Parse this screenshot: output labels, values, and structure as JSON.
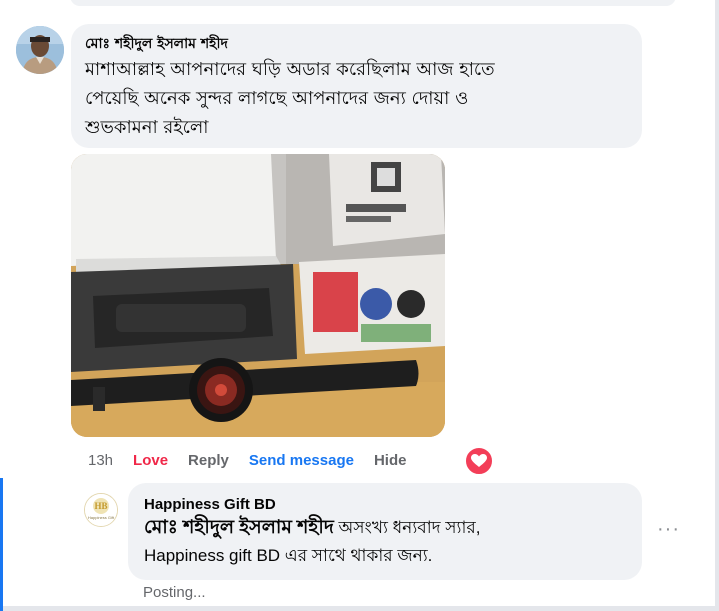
{
  "comment": {
    "author": "মোঃ শহীদুল ইসলাম শহীদ",
    "lines": [
      "মাশাআল্লাহ আপনাদের ঘড়ি অডার করেছিলাম আজ হাতে",
      "পেয়েছি অনেক সুন্দর লাগছে আপনাদের জন্য দোয়া ও",
      "শুভকামনা রইলো"
    ]
  },
  "actions": {
    "time": "13h",
    "love": "Love",
    "reply": "Reply",
    "send_message": "Send message",
    "hide": "Hide",
    "reaction_icon": "heart-icon"
  },
  "reply": {
    "author": "Happiness Gift BD",
    "mention": "মোঃ শহীদুল ইসলাম শহীদ",
    "text_part1": " অসংখ্য ধন্যবাদ স্যার,",
    "text_line2": "Happiness gift BD এর সাথে থাকার জন্য.",
    "logo_text": "HB",
    "logo_subtext": "Happiness Gift",
    "status": "Posting...",
    "more_icon": "more-options-icon"
  },
  "colors": {
    "bubble": "#f0f2f5",
    "love": "#f02849",
    "link": "#1877f2",
    "muted": "#65676b"
  }
}
